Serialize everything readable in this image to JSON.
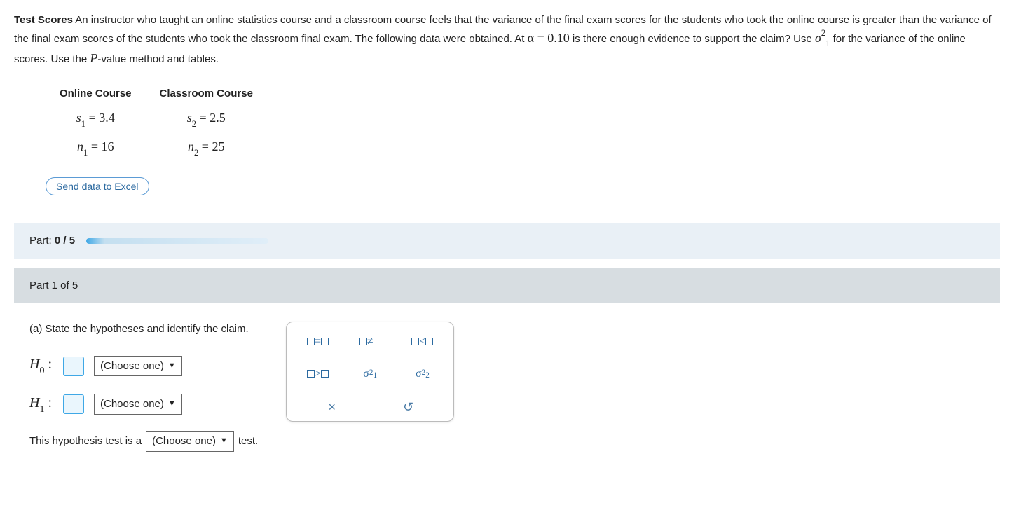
{
  "problem": {
    "title_bold": "Test Scores",
    "text_1": " An instructor who taught an online statistics course and a classroom course feels that the variance of the final exam scores for the students who took the online course is greater than the variance of the final exam scores of the students who took the classroom final exam. The following data were obtained. At ",
    "alpha_expr": "α = 0.10",
    "text_2": " is there enough evidence to support the claim? Use ",
    "text_3": " for the variance of the online scores. Use the ",
    "pvalue_word": "P",
    "text_4": "-value method and tables."
  },
  "data_table": {
    "headers": [
      "Online Course",
      "Classroom Course"
    ],
    "rows": [
      {
        "c1_sym": "s",
        "c1_sub": "1",
        "c1_val": "3.4",
        "c2_sym": "s",
        "c2_sub": "2",
        "c2_val": "2.5"
      },
      {
        "c1_sym": "n",
        "c1_sub": "1",
        "c1_val": "16",
        "c2_sym": "n",
        "c2_sub": "2",
        "c2_val": "25"
      }
    ]
  },
  "excel_button": "Send data to Excel",
  "progress": {
    "label_prefix": "Part: ",
    "current": "0",
    "sep": " / ",
    "total": "5"
  },
  "part_header": "Part 1 of 5",
  "prompt_a": "(a) State the hypotheses and identify the claim.",
  "hypotheses": {
    "h0_label": "H",
    "h0_sub": "0",
    "h1_label": "H",
    "h1_sub": "1",
    "colon": " :",
    "dropdown_placeholder": "(Choose one)"
  },
  "sentence": {
    "before": "This hypothesis test is a ",
    "dropdown_placeholder": "(Choose one)",
    "after": " test."
  },
  "palette": {
    "eq": "=",
    "neq": "≠",
    "lt": "<",
    "gt": ">",
    "sigma": "σ",
    "sub1": "1",
    "sub2": "2",
    "sup2": "2",
    "clear": "×",
    "reset": "↺"
  }
}
